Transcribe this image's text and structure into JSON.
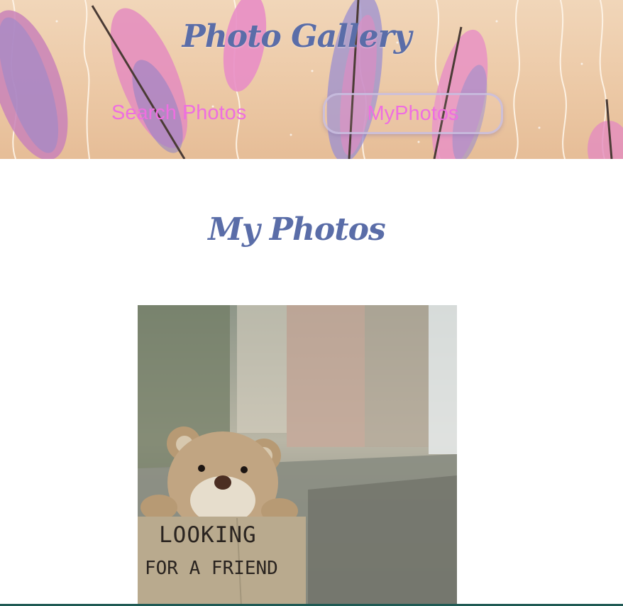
{
  "header": {
    "title": "Photo Gallery",
    "nav": [
      {
        "label": "Search Photos"
      },
      {
        "label": "MyPhotos",
        "active": true
      }
    ]
  },
  "main": {
    "heading": "My Photos",
    "photos": [
      {
        "sign_lines": [
          "LOOKING",
          "FOR A FRIEND"
        ]
      }
    ]
  },
  "colors": {
    "title": "#5a6da8",
    "nav_link": "#ee6fe0",
    "banner": "#ecc9a6",
    "bottom_rule": "#1f5a54"
  }
}
